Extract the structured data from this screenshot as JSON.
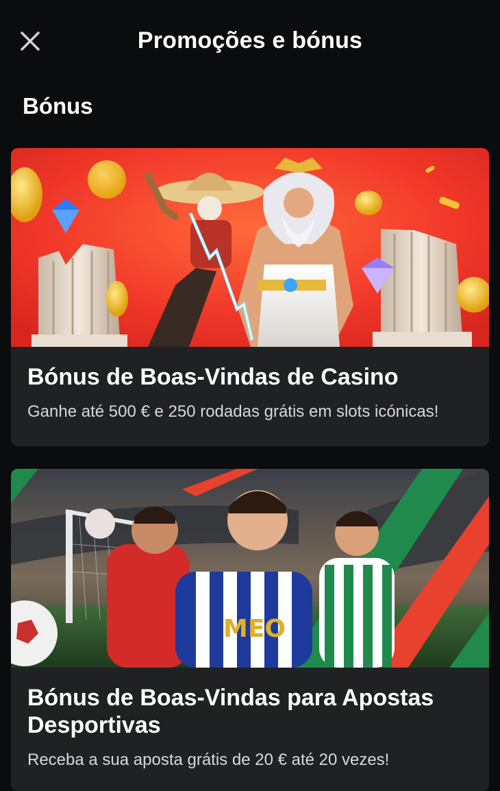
{
  "header": {
    "title": "Promoções e bónus",
    "close_icon": "close-icon"
  },
  "section": {
    "title": "Bónus"
  },
  "cards": [
    {
      "title": "Bónus de Boas-Vindas de Casino",
      "description": "Ganhe até 500 € e 250 rodadas grátis em slots icónicas!",
      "image": "casino-banner-zeus-columns-coins",
      "accent": "#f0432d"
    },
    {
      "title": "Bónus de Boas-Vindas para Apostas Desportivas",
      "description": "Receba a sua aposta grátis de 20 € até 20 vezes!",
      "image": "sports-banner-football-players-stadium",
      "accent": "#1f8a4c"
    }
  ],
  "colors": {
    "background": "#0b0c0e",
    "card": "#1f2123",
    "text": "#ffffff",
    "subtext": "#d6d8da"
  }
}
